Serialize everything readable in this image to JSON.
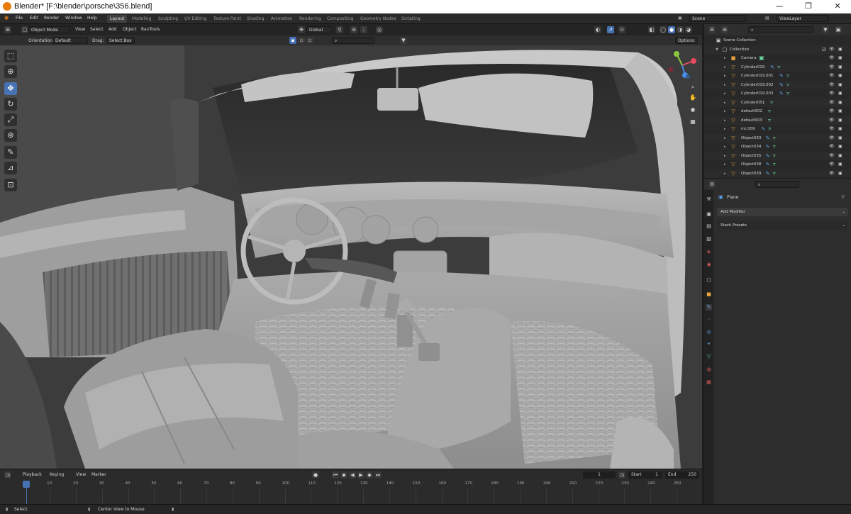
{
  "window": {
    "title": "Blender* [F:\\blender\\porsche\\356.blend]",
    "minimize": "—",
    "maximize": "❐",
    "close": "✕"
  },
  "menu": [
    "File",
    "Edit",
    "Render",
    "Window",
    "Help"
  ],
  "workspaces": [
    "Layout",
    "Modeling",
    "Sculpting",
    "UV Editing",
    "Texture Paint",
    "Shading",
    "Animation",
    "Rendering",
    "Compositing",
    "Geometry Nodes",
    "Scripting"
  ],
  "scene": {
    "scene_name": "Scene",
    "view_layer": "ViewLayer"
  },
  "viewport_header": {
    "mode": "Object Mode",
    "menus": [
      "View",
      "Select",
      "Add",
      "Object",
      "RanTools"
    ],
    "transform_space": "Global"
  },
  "tool_settings": {
    "orientation_label": "Orientation:",
    "orientation_value": "Default",
    "drag_label": "Drag:",
    "drag_value": "Select Box",
    "options": "Options"
  },
  "toolbar_icons": [
    "select-box-icon",
    "cursor-icon",
    "move-icon",
    "rotate-icon",
    "scale-icon",
    "transform-icon",
    "annotate-icon",
    "measure-icon",
    "add-cube-icon"
  ],
  "outliner": {
    "scene_collection": "Scene Collection",
    "collection": "Collection",
    "items": [
      {
        "name": "Camera",
        "type": "camera",
        "mods": false
      },
      {
        "name": "Cylinder019",
        "type": "mesh",
        "mods": true
      },
      {
        "name": "Cylinder019.001",
        "type": "mesh",
        "mods": true
      },
      {
        "name": "Cylinder019.002",
        "type": "mesh",
        "mods": true
      },
      {
        "name": "Cylinder019.003",
        "type": "mesh",
        "mods": true
      },
      {
        "name": "Cylinder051",
        "type": "mesh",
        "mods": false
      },
      {
        "name": "default002",
        "type": "mesh",
        "mods": false
      },
      {
        "name": "default003",
        "type": "mesh",
        "mods": false
      },
      {
        "name": "int.009",
        "type": "mesh",
        "mods": true
      },
      {
        "name": "Object033",
        "type": "mesh",
        "mods": true
      },
      {
        "name": "Object034",
        "type": "mesh",
        "mods": true
      },
      {
        "name": "Object035",
        "type": "mesh",
        "mods": true
      },
      {
        "name": "Object038",
        "type": "mesh",
        "mods": true
      },
      {
        "name": "Object039",
        "type": "mesh",
        "mods": true
      }
    ]
  },
  "properties": {
    "object_name": "Plane",
    "add_modifier": "Add Modifier",
    "stack_presets": "Stack Presets"
  },
  "timeline": {
    "menus": [
      "Playback",
      "Keying",
      "View",
      "Marker"
    ],
    "current_frame": "1",
    "start_label": "Start",
    "start": "1",
    "end_label": "End",
    "end": "250",
    "ticks": [
      "1",
      "10",
      "20",
      "30",
      "40",
      "50",
      "60",
      "70",
      "80",
      "90",
      "100",
      "110",
      "120",
      "130",
      "140",
      "150",
      "160",
      "170",
      "180",
      "190",
      "200",
      "210",
      "220",
      "230",
      "240",
      "250"
    ]
  },
  "statusbar": {
    "select": "Select",
    "center_view": "Center View to Mouse"
  },
  "colors": {
    "accent": "#4772b3",
    "mesh_icon": "#6cd9a0",
    "modifier_icon": "#5ea2e8",
    "object_icon": "#e8a23e",
    "playhead": "#4772b3"
  }
}
